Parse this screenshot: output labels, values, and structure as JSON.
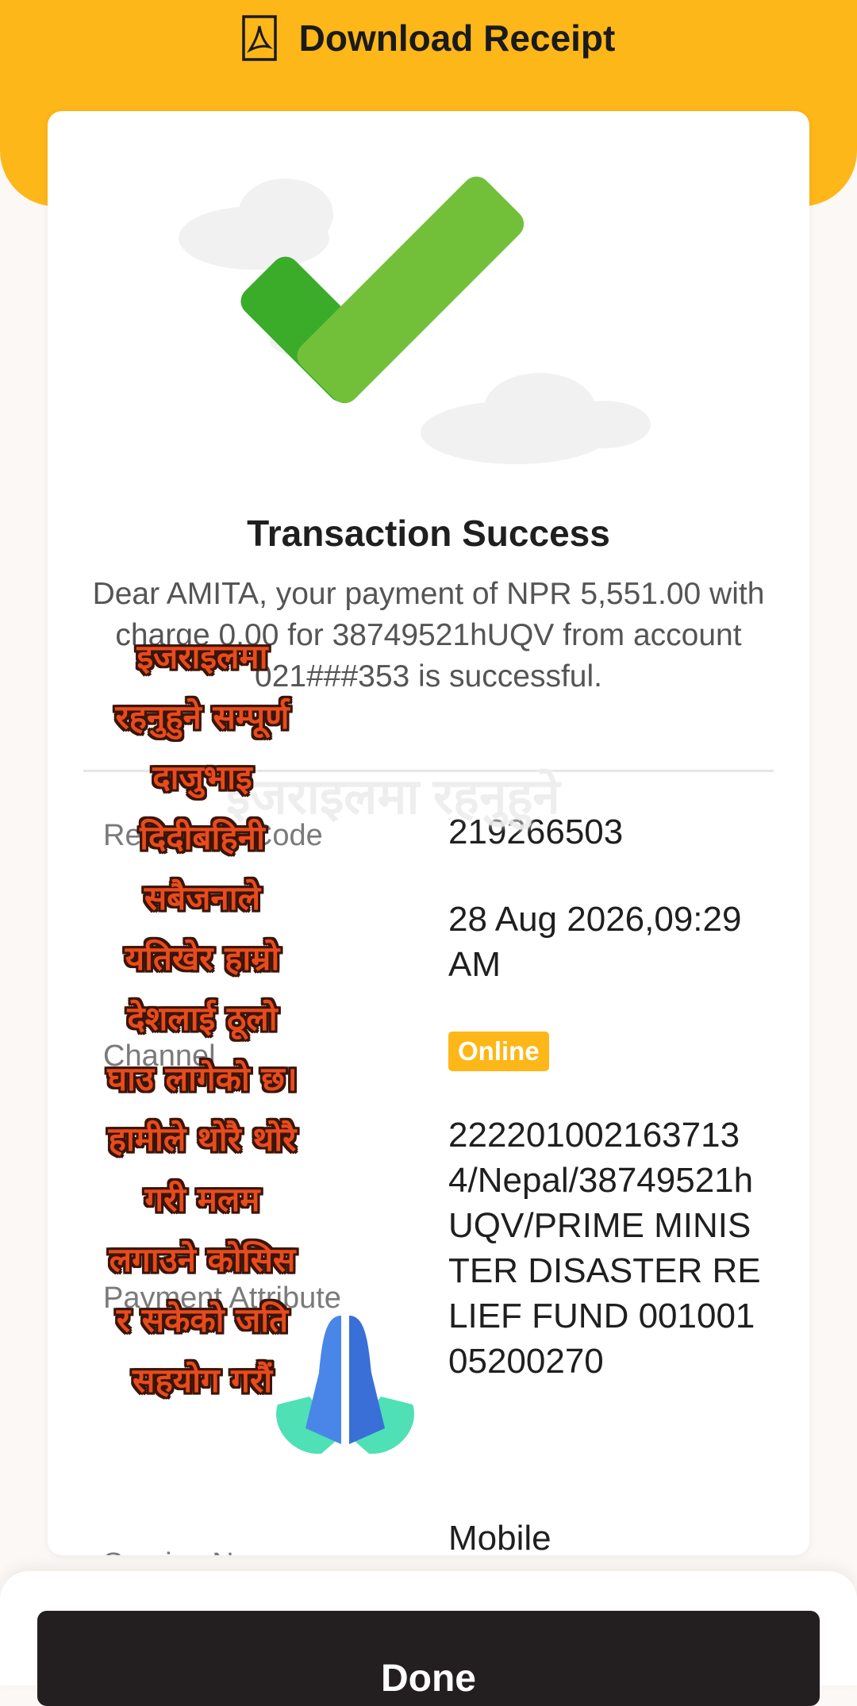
{
  "header": {
    "download_label": "Download Receipt",
    "accent_color": "#fdb719",
    "download_icon": "pdf-icon"
  },
  "status": {
    "icon": "checkmark-icon",
    "title": "Transaction Success"
  },
  "message": "Dear AMITA, your payment of NPR 5,551.00 with charge 0.00 for 38749521hUQV from account 021###353 is successful.",
  "details": {
    "reference": {
      "label": "Reference Code",
      "value": "219266503"
    },
    "date": {
      "label": "",
      "value": "28 Aug 2026,09:29 AM"
    },
    "channel": {
      "label": "Channel",
      "value": "Online"
    },
    "payment_attribute": {
      "label": "Payment Attribute",
      "value": "2222010021637134/Nepal/38749521hUQV/PRIME MINISTER DISASTER RELIEF FUND 00100105200270"
    },
    "service": {
      "label": "Service Name",
      "value": "Mobile"
    }
  },
  "overlay": {
    "ghost_text": "इजराइलमा रहनुहुने",
    "lines": [
      "इजराइलमा",
      "रहनुहुने सम्पूर्ण",
      "दाजुभाइ",
      "दिदीबहिनी",
      "सबैजनाले",
      "यतिखेर हाम्रो",
      "देशलाई ठूलो",
      "घाउ लागेको छ।",
      "हामीले थोरै थोरै",
      "गरी मलम",
      "लगाउने कोसिस",
      "र सकेको जति",
      "सहयोग गरौं"
    ],
    "emoji": "folded-hands-icon"
  },
  "footer": {
    "done_label": "Done"
  }
}
